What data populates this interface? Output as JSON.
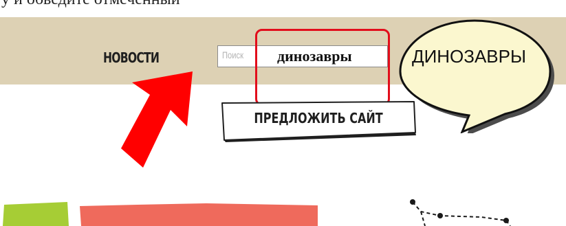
{
  "caption": {
    "text": "у и обведите отмеченный"
  },
  "header": {
    "nav_news_label": "НОВОСТИ",
    "search": {
      "placeholder": "Поиск",
      "value": "динозавры"
    },
    "suggest_button_label": "ПРЕДЛОЖИТЬ САЙТ"
  },
  "annotation": {
    "bubble_text": "ДИНОЗАВРЫ",
    "highlight_color": "#e20d1b",
    "arrow_color": "#ff0000",
    "bubble_fill": "#fbf7cf"
  },
  "colors": {
    "header_bg": "#ddd1b4",
    "green_tile": "#a6cd35",
    "coral_tile": "#ef6a5c"
  },
  "icons": [
    "pointer-arrow-icon",
    "speech-bubble-icon",
    "constellation-icon"
  ]
}
